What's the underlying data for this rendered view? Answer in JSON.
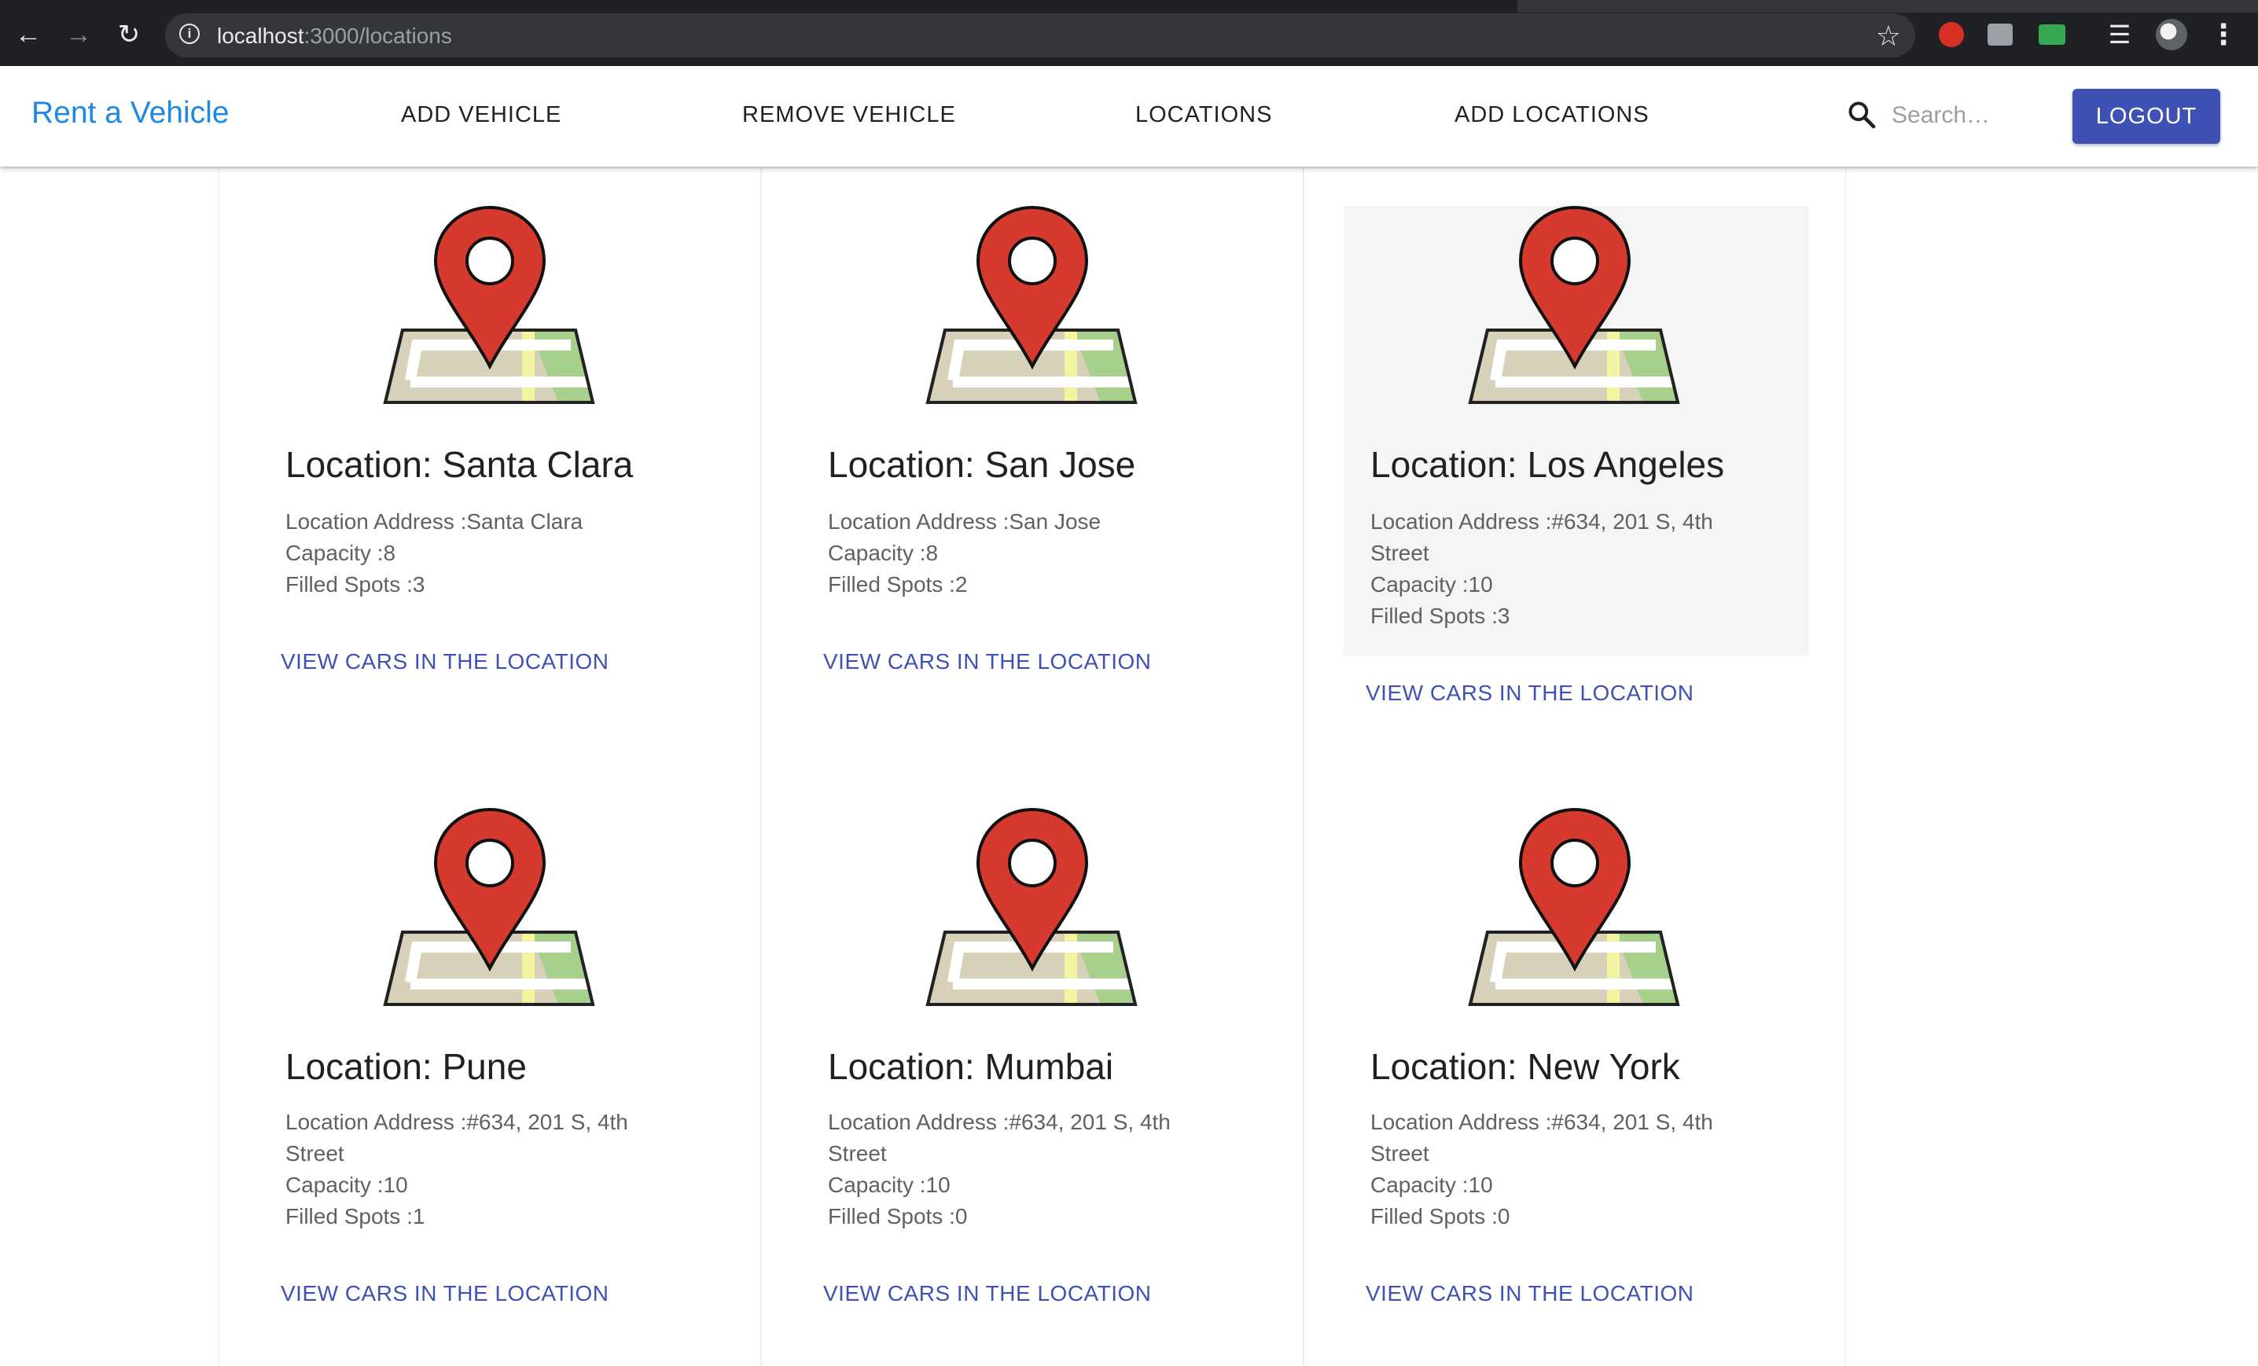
{
  "browser": {
    "url_host": "localhost",
    "url_path": ":3000/locations"
  },
  "appbar": {
    "brand": "Rent a Vehicle",
    "nav": [
      {
        "label": "ADD VEHICLE"
      },
      {
        "label": "REMOVE VEHICLE"
      },
      {
        "label": "LOCATIONS"
      },
      {
        "label": "ADD LOCATIONS"
      }
    ],
    "search_placeholder": "Search…",
    "logout_label": "LOGOUT"
  },
  "colors": {
    "brand": "#1e88e5",
    "primary": "#3f51b5",
    "pin": "#d63a2f"
  },
  "locations": [
    {
      "title": "Location: Santa Clara",
      "address": "Location Address :Santa Clara",
      "capacity": "Capacity :8",
      "filled": "Filled Spots :3",
      "link": "VIEW CARS IN THE LOCATION"
    },
    {
      "title": "Location: San Jose",
      "address": "Location Address :San Jose",
      "capacity": "Capacity :8",
      "filled": "Filled Spots :2",
      "link": "VIEW CARS IN THE LOCATION"
    },
    {
      "title": "Location: Los Angeles",
      "address": "Location Address :#634, 201 S, 4th Street",
      "capacity": "Capacity :10",
      "filled": "Filled Spots :3",
      "link": "VIEW CARS IN THE LOCATION"
    },
    {
      "title": "Location: Pune",
      "address": "Location Address :#634, 201 S, 4th Street",
      "capacity": "Capacity :10",
      "filled": "Filled Spots :1",
      "link": "VIEW CARS IN THE LOCATION"
    },
    {
      "title": "Location: Mumbai",
      "address": "Location Address :#634, 201 S, 4th Street",
      "capacity": "Capacity :10",
      "filled": "Filled Spots :0",
      "link": "VIEW CARS IN THE LOCATION"
    },
    {
      "title": "Location: New York",
      "address": "Location Address :#634, 201 S, 4th Street",
      "capacity": "Capacity :10",
      "filled": "Filled Spots :0",
      "link": "VIEW CARS IN THE LOCATION"
    }
  ]
}
